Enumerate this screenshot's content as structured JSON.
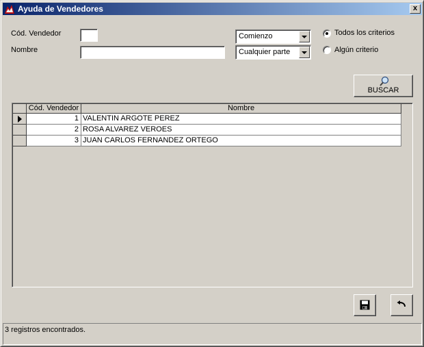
{
  "window": {
    "title": "Ayuda de Vendedores",
    "close_label": "x"
  },
  "filters": {
    "cod_vendedor_label": "Cód. Vendedor",
    "cod_vendedor_value": "",
    "nombre_label": "Nombre",
    "nombre_value": "",
    "combo1_value": "Comienzo",
    "combo2_value": "Cualquier parte",
    "radio_all_label": "Todos los criterios",
    "radio_any_label": "Algún criterio",
    "radio_selected": "all"
  },
  "buscar_button": {
    "label": "BUSCAR",
    "icon": "magnifier-icon"
  },
  "grid": {
    "columns": [
      "Cód. Vendedor",
      "Nombre"
    ],
    "rows": [
      {
        "cod": "1",
        "nombre": "VALENTIN ARGOTE PEREZ"
      },
      {
        "cod": "2",
        "nombre": "ROSA ALVAREZ VEROES"
      },
      {
        "cod": "3",
        "nombre": "JUAN CARLOS FERNANDEZ ORTEGO"
      }
    ],
    "current_row": 0
  },
  "actions": {
    "save_icon": "floppy-disk-icon",
    "undo_icon": "undo-arrow-icon"
  },
  "status": {
    "text": "3 registros encontrados."
  },
  "colors": {
    "face": "#d4d0c8",
    "title_start": "#0a246a",
    "title_end": "#a6caf0"
  }
}
